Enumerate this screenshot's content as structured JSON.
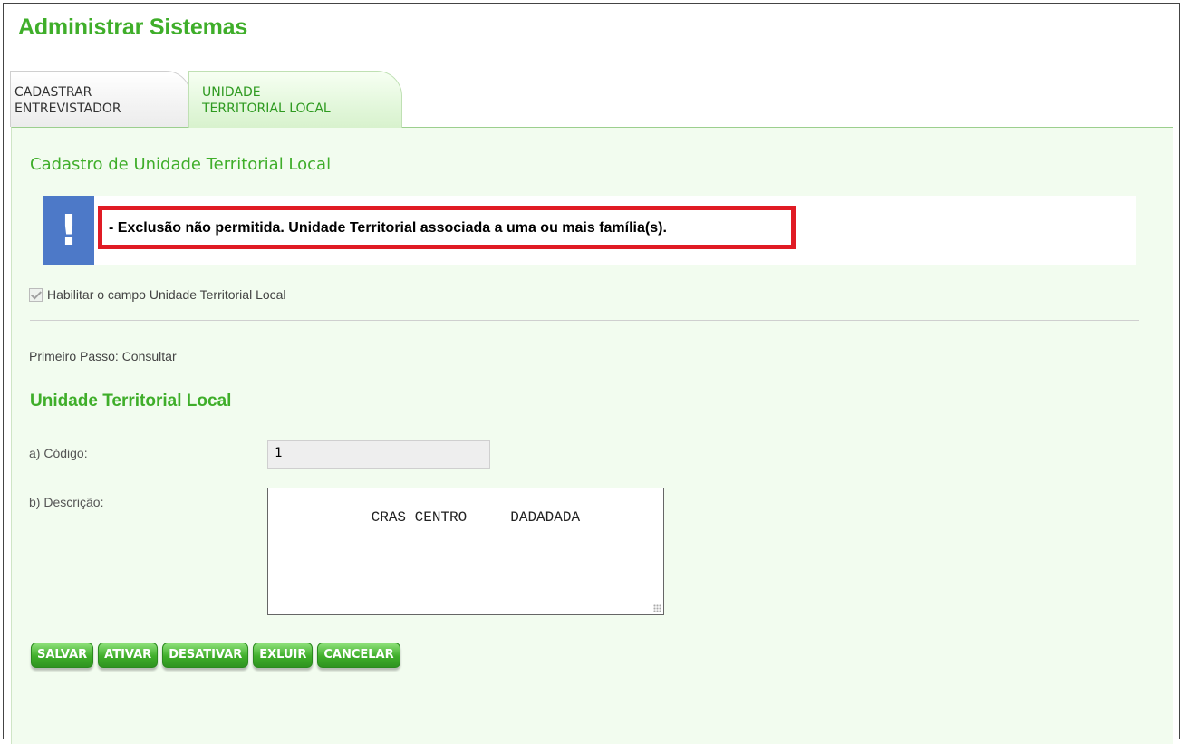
{
  "app": {
    "title": "Administrar Sistemas"
  },
  "tabs": [
    {
      "label": "CADASTRAR\nENTREVISTADOR",
      "active": false
    },
    {
      "label": "UNIDADE\nTERRITORIAL LOCAL",
      "active": true
    }
  ],
  "section": {
    "title": "Cadastro de Unidade Territorial Local"
  },
  "alert": {
    "icon": "exclamation-icon",
    "icon_glyph": "!",
    "message": "- Exclusão não permitida. Unidade Territorial associada a uma ou mais família(s)."
  },
  "checkbox": {
    "label": "Habilitar o campo Unidade Territorial Local",
    "checked": true,
    "disabled": true
  },
  "step_text": "Primeiro Passo: Consultar",
  "form": {
    "title": "Unidade Territorial Local",
    "codigo_label": "a) Código:",
    "codigo_value": "1",
    "descricao_label": "b) Descrição:",
    "descricao_value": "     CRAS CENTRO     DADADADA"
  },
  "buttons": {
    "salvar": "SALVAR",
    "ativar": "ATIVAR",
    "desativar": "DESATIVAR",
    "excluir": "EXLUIR",
    "cancelar": "CANCELAR"
  },
  "colors": {
    "accent_green": "#3fae2a",
    "panel_bg": "#f2fcef",
    "alert_border": "#e01b24",
    "alert_icon_bg": "#4d79c8"
  }
}
